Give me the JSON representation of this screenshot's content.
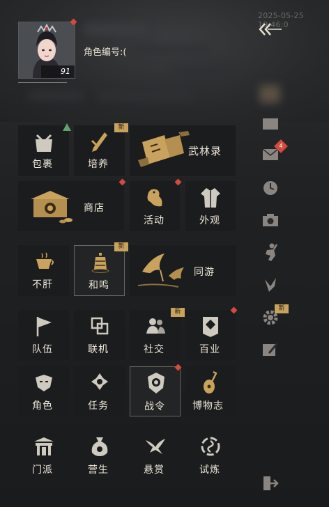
{
  "status": {
    "timestamp": "2025-05-25 19:46:0"
  },
  "profile": {
    "level": "91",
    "role_id_label": "角色编号:("
  },
  "grid": {
    "bag": "包裹",
    "cultivate": "培养",
    "wulinlu": "武林录",
    "shop": "商店",
    "activity": "活动",
    "appearance": "外观",
    "bugan": "不肝",
    "heming": "和鸣",
    "tongyou": "同游",
    "team": "队伍",
    "online": "联机",
    "social": "社交",
    "baiye": "百业",
    "character": "角色",
    "quest": "任务",
    "battlepass": "战令",
    "museum": "博物志",
    "sect": "门派",
    "livelihood": "营生",
    "bounty": "悬赏",
    "trial": "试炼"
  },
  "badges": {
    "new": "新",
    "mail_count": "4"
  },
  "colors": {
    "gold": "#c9a35d",
    "red": "#d24b3f",
    "green": "#5fa36b"
  }
}
